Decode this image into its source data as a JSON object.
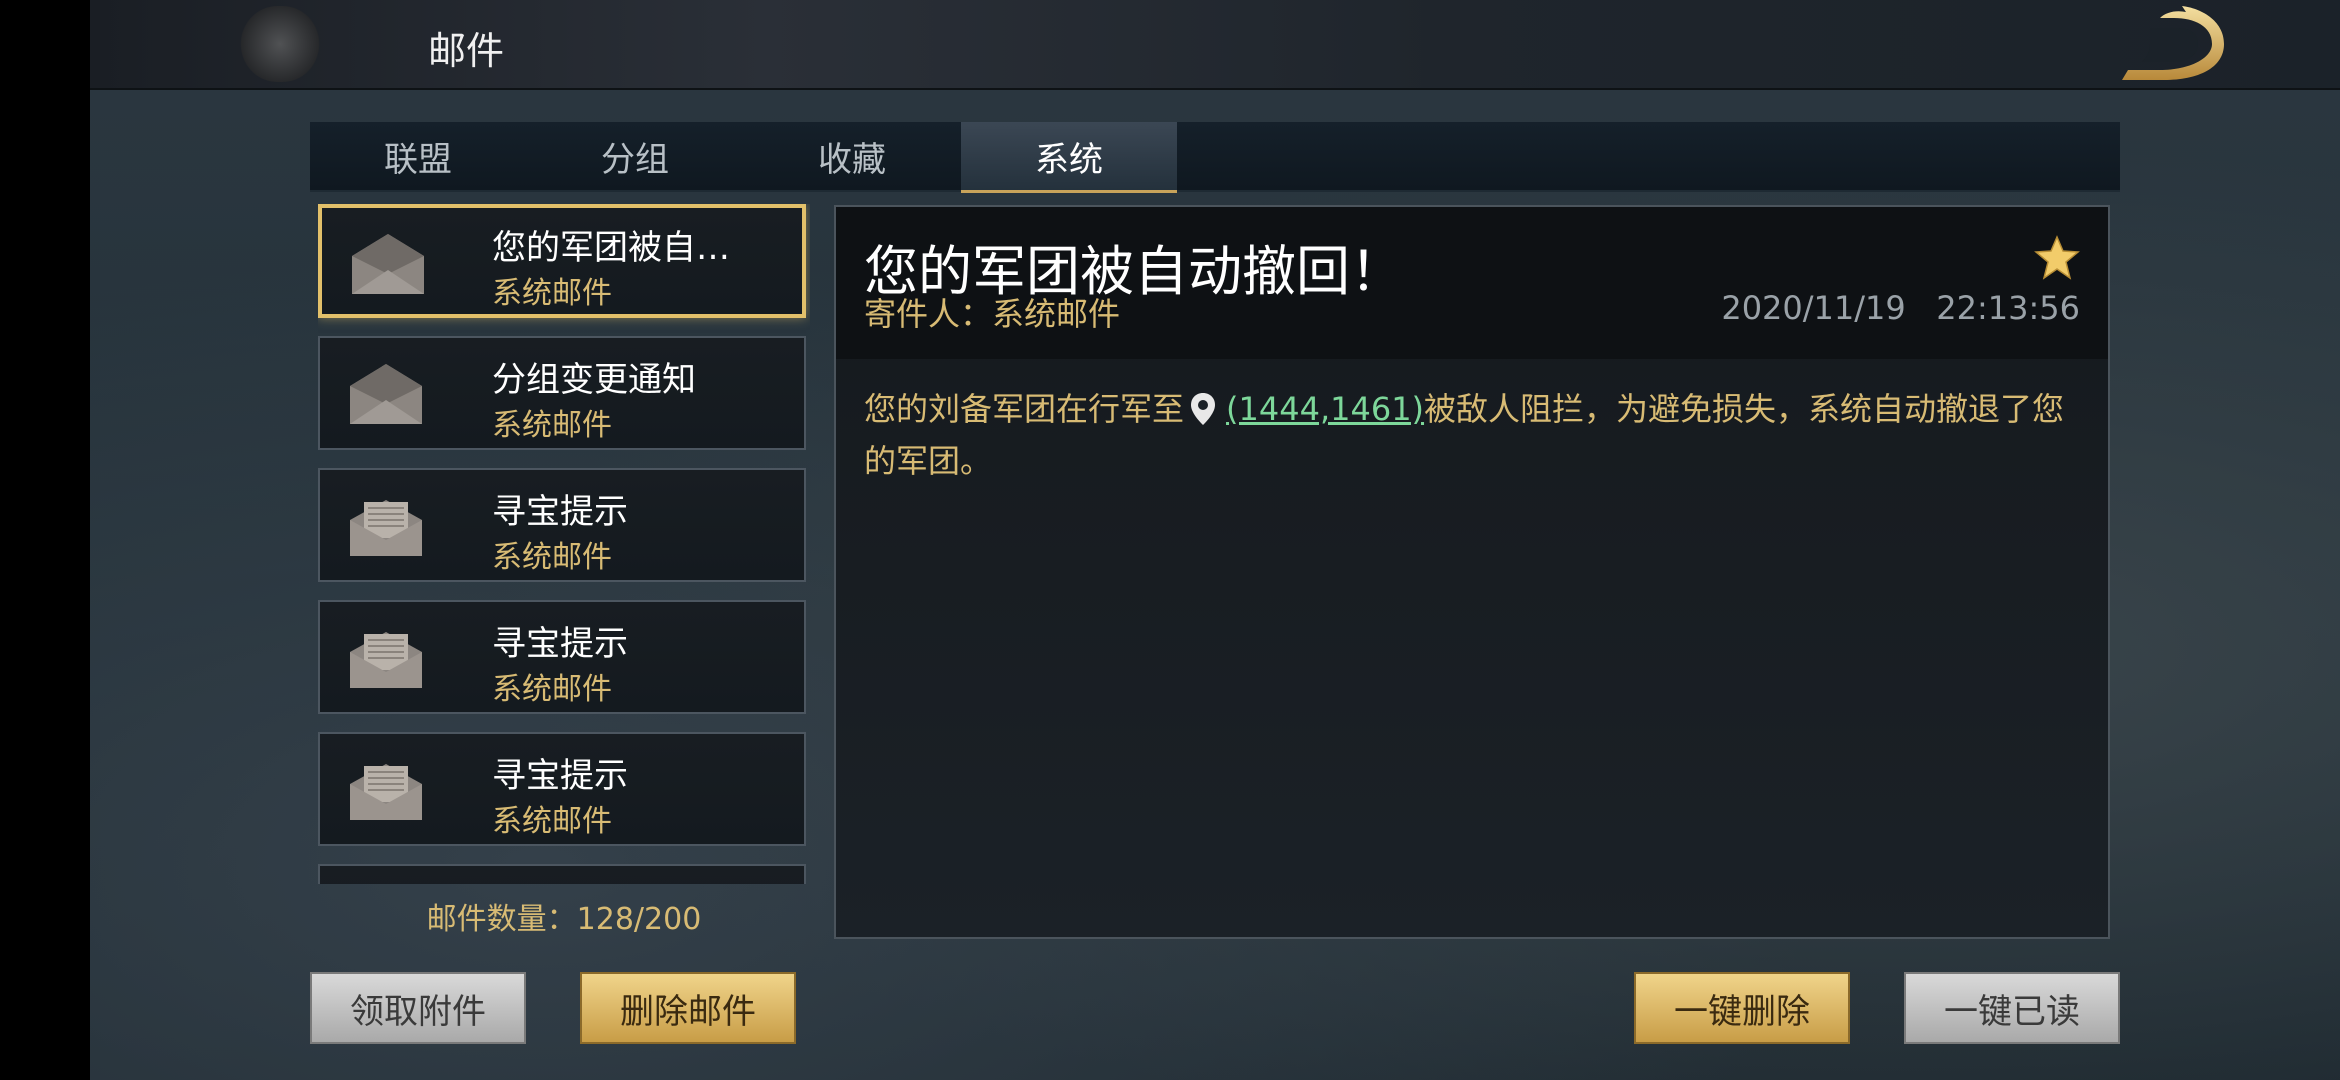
{
  "header": {
    "title": "邮件",
    "logo_icon": "dragon-logo-icon"
  },
  "tabs": [
    {
      "label": "联盟",
      "active": false
    },
    {
      "label": "分组",
      "active": false
    },
    {
      "label": "收藏",
      "active": false
    },
    {
      "label": "系统",
      "active": true
    }
  ],
  "mail_list": [
    {
      "title": "您的军团被自…",
      "sender": "系统邮件",
      "icon": "open-envelope-icon",
      "selected": true
    },
    {
      "title": "分组变更通知",
      "sender": "系统邮件",
      "icon": "open-envelope-icon",
      "selected": false
    },
    {
      "title": "寻宝提示",
      "sender": "系统邮件",
      "icon": "envelope-with-letter-icon",
      "selected": false
    },
    {
      "title": "寻宝提示",
      "sender": "系统邮件",
      "icon": "envelope-with-letter-icon",
      "selected": false
    },
    {
      "title": "寻宝提示",
      "sender": "系统邮件",
      "icon": "envelope-with-letter-icon",
      "selected": false
    }
  ],
  "mail_count": "邮件数量：128/200",
  "detail": {
    "title": "您的军团被自动撤回！",
    "sender": "寄件人：系统邮件",
    "date": "2020/11/19",
    "time": "22:13:56",
    "starred": true,
    "body_before": "您的刘备军团在行军至",
    "coord_link": "(1444,1461)",
    "body_after": "被敌人阻拦，为避免损失，系统自动撤退了您的军团。"
  },
  "buttons": {
    "claim_attachments": "领取附件",
    "delete_mail": "删除邮件",
    "delete_all": "一键删除",
    "read_all": "一键已读"
  },
  "colors": {
    "accent_gold": "#d8bb74",
    "link_green": "#7dd79a",
    "selected_border": "#e2c06a"
  }
}
